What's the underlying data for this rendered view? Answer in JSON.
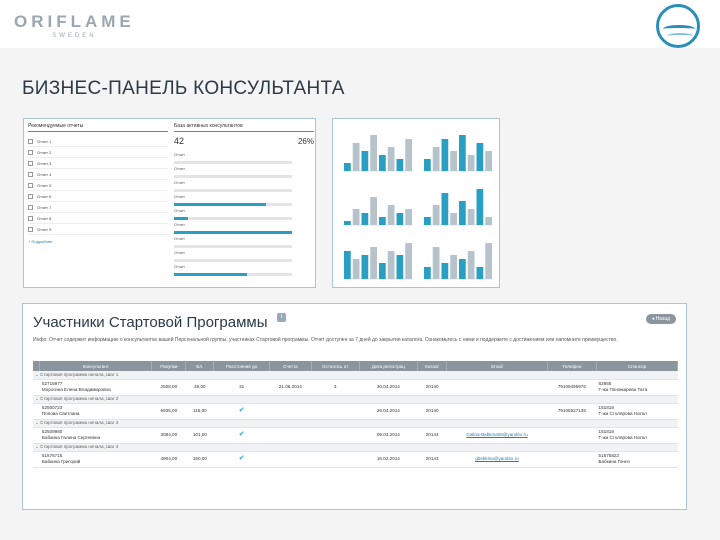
{
  "header": {
    "brand": "ORIFLAME",
    "brand_sub": "SWEDEN",
    "page_title": "БИЗНЕС-ПАНЕЛЬ КОНСУЛЬТАНТА"
  },
  "dashboard": {
    "left_title": "Рекомендуемые отчеты",
    "right_title": "База активных консультантов",
    "big_value": "42",
    "big_pct": "26%",
    "items": [
      "Отчет 1",
      "Отчет 2",
      "Отчет 3",
      "Отчет 4",
      "Отчет 5",
      "Отчет 6",
      "Отчет 7",
      "Отчет 8",
      "Отчет 9"
    ],
    "more_link": "+ Подробнее",
    "bars": [
      {
        "label": "Отчет",
        "fill": 0.0
      },
      {
        "label": "Отчет",
        "fill": 0.0
      },
      {
        "label": "Отчет",
        "fill": 0.0
      },
      {
        "label": "Отчет",
        "fill": 0.78
      },
      {
        "label": "Отчет",
        "fill": 0.12
      },
      {
        "label": "Отчет",
        "fill": 1.0
      },
      {
        "label": "Отчет",
        "fill": 0.0
      },
      {
        "label": "Отчет",
        "fill": 0.0
      },
      {
        "label": "Отчет",
        "fill": 0.62
      }
    ]
  },
  "mini_charts": [
    {
      "type": "bar",
      "colors": [
        "#2a9fc4",
        "#b7c3cb"
      ],
      "values": [
        0.2,
        0.7,
        0.5,
        0.9,
        0.4,
        0.6,
        0.3,
        0.8
      ]
    },
    {
      "type": "bar",
      "colors": [
        "#2a9fc4",
        "#b7c3cb"
      ],
      "values": [
        0.3,
        0.6,
        0.8,
        0.5,
        0.9,
        0.4,
        0.7,
        0.5
      ]
    },
    {
      "type": "bar",
      "colors": [
        "#2a9fc4",
        "#b7c3cb"
      ],
      "values": [
        0.1,
        0.4,
        0.3,
        0.7,
        0.2,
        0.5,
        0.3,
        0.4
      ]
    },
    {
      "type": "bar",
      "colors": [
        "#2a9fc4",
        "#b7c3cb"
      ],
      "values": [
        0.2,
        0.5,
        0.8,
        0.3,
        0.6,
        0.4,
        0.9,
        0.2
      ]
    },
    {
      "type": "bar",
      "colors": [
        "#2a9fc4",
        "#b7c3cb"
      ],
      "values": [
        0.7,
        0.5,
        0.6,
        0.8,
        0.4,
        0.7,
        0.6,
        0.9
      ]
    },
    {
      "type": "bar",
      "colors": [
        "#2a9fc4",
        "#b7c3cb"
      ],
      "values": [
        0.3,
        0.8,
        0.4,
        0.6,
        0.5,
        0.7,
        0.3,
        0.9
      ]
    }
  ],
  "report": {
    "title": "Участники Стартовой Программы",
    "back_button": "◂ Назад",
    "description": "Инфо: Отчет содержит информацию о консультантах вашей Персональной группы, участниках Стартовой программы. Отчет доступен за 7 дней до закрытия каталога. Ознакомьтесь с ними и поддержите с достижением или напомните преимущество.",
    "columns": [
      "Консультант",
      "Покупки",
      "Бл.",
      "Расстояние до",
      "Счетта",
      "Осталось от",
      "Дата регистрац",
      "Катаог",
      "Email",
      "Телефон",
      "Спонсор"
    ],
    "groups": [
      {
        "label": "Стартовая программа начала, Шаг 1",
        "id": "52715977",
        "name": "Морогина Елена Владимировна",
        "cells": [
          "2508,00",
          "49,00",
          "31",
          "21.06.2014",
          "3",
          "30.04.2014",
          "20140",
          "",
          "79109495976",
          "82955 / Г-жа Пономарева Тата"
        ],
        "check": false
      },
      {
        "label": "Стартовая программа начала, Шаг 2",
        "id": "52500723",
        "name": "Попова Светлана",
        "cells": [
          "6935,00",
          "115,00",
          "",
          "",
          "",
          "26.04.2014",
          "20140",
          "",
          "79105527135",
          "151818 / Г-жа Столярова Натал"
        ],
        "check": true
      },
      {
        "label": "Стартовая программа начала, Шаг 3",
        "id": "52509980",
        "name": "Бабкина Галина Сергеевна",
        "cells": [
          "3084,00",
          "101,00",
          "",
          "",
          "",
          "09.03.2014",
          "20144",
          "Galina-Babkina08@yandex.ru",
          "",
          "151818 / Г-жа Столярова Натал"
        ],
        "check": true
      },
      {
        "label": "Стартовая программа начала, Шаг 4",
        "id": "51676715",
        "name": "Бабкина Григорий",
        "cells": [
          "4904,00",
          "160,00",
          "",
          "",
          "",
          "16.02.2014",
          "20143",
          "gbebkina@yandex.ru",
          "",
          "51675823 / Бабкина Гоннэ"
        ],
        "check": true
      }
    ]
  }
}
